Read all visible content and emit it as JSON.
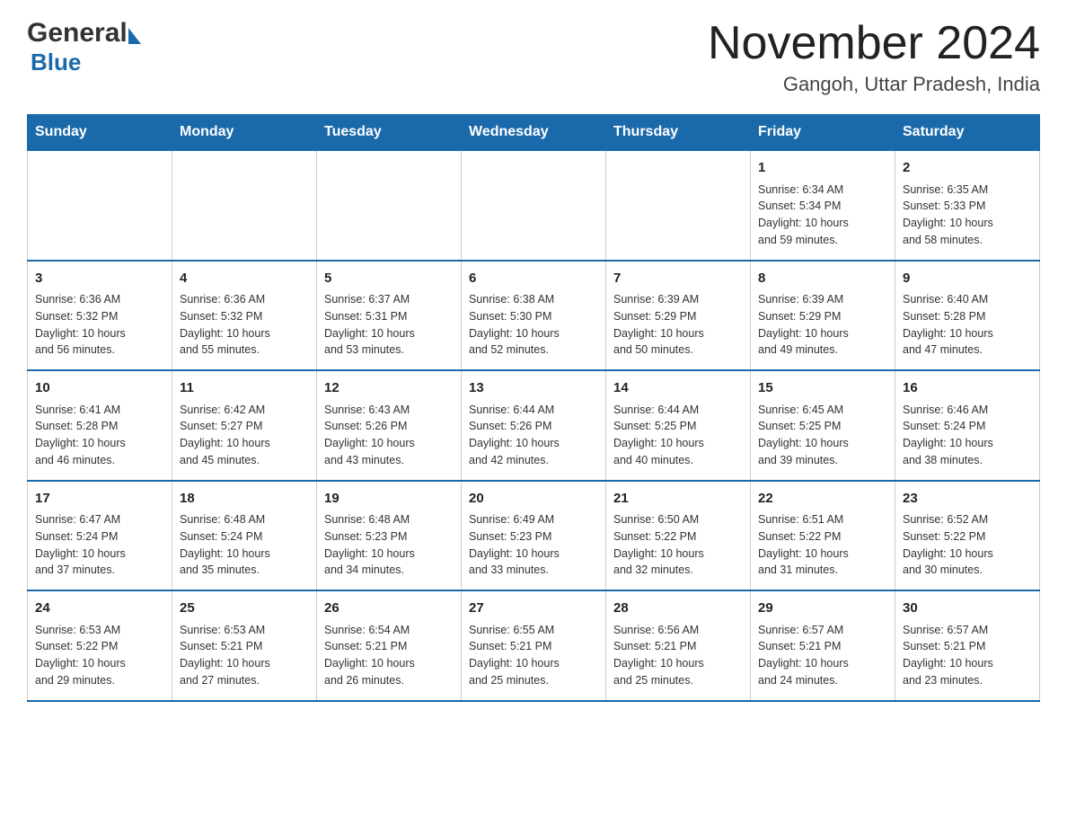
{
  "header": {
    "title": "November 2024",
    "location": "Gangoh, Uttar Pradesh, India",
    "logo_general": "General",
    "logo_blue": "Blue"
  },
  "calendar": {
    "days_of_week": [
      "Sunday",
      "Monday",
      "Tuesday",
      "Wednesday",
      "Thursday",
      "Friday",
      "Saturday"
    ],
    "weeks": [
      [
        {
          "day": "",
          "info": ""
        },
        {
          "day": "",
          "info": ""
        },
        {
          "day": "",
          "info": ""
        },
        {
          "day": "",
          "info": ""
        },
        {
          "day": "",
          "info": ""
        },
        {
          "day": "1",
          "info": "Sunrise: 6:34 AM\nSunset: 5:34 PM\nDaylight: 10 hours\nand 59 minutes."
        },
        {
          "day": "2",
          "info": "Sunrise: 6:35 AM\nSunset: 5:33 PM\nDaylight: 10 hours\nand 58 minutes."
        }
      ],
      [
        {
          "day": "3",
          "info": "Sunrise: 6:36 AM\nSunset: 5:32 PM\nDaylight: 10 hours\nand 56 minutes."
        },
        {
          "day": "4",
          "info": "Sunrise: 6:36 AM\nSunset: 5:32 PM\nDaylight: 10 hours\nand 55 minutes."
        },
        {
          "day": "5",
          "info": "Sunrise: 6:37 AM\nSunset: 5:31 PM\nDaylight: 10 hours\nand 53 minutes."
        },
        {
          "day": "6",
          "info": "Sunrise: 6:38 AM\nSunset: 5:30 PM\nDaylight: 10 hours\nand 52 minutes."
        },
        {
          "day": "7",
          "info": "Sunrise: 6:39 AM\nSunset: 5:29 PM\nDaylight: 10 hours\nand 50 minutes."
        },
        {
          "day": "8",
          "info": "Sunrise: 6:39 AM\nSunset: 5:29 PM\nDaylight: 10 hours\nand 49 minutes."
        },
        {
          "day": "9",
          "info": "Sunrise: 6:40 AM\nSunset: 5:28 PM\nDaylight: 10 hours\nand 47 minutes."
        }
      ],
      [
        {
          "day": "10",
          "info": "Sunrise: 6:41 AM\nSunset: 5:28 PM\nDaylight: 10 hours\nand 46 minutes."
        },
        {
          "day": "11",
          "info": "Sunrise: 6:42 AM\nSunset: 5:27 PM\nDaylight: 10 hours\nand 45 minutes."
        },
        {
          "day": "12",
          "info": "Sunrise: 6:43 AM\nSunset: 5:26 PM\nDaylight: 10 hours\nand 43 minutes."
        },
        {
          "day": "13",
          "info": "Sunrise: 6:44 AM\nSunset: 5:26 PM\nDaylight: 10 hours\nand 42 minutes."
        },
        {
          "day": "14",
          "info": "Sunrise: 6:44 AM\nSunset: 5:25 PM\nDaylight: 10 hours\nand 40 minutes."
        },
        {
          "day": "15",
          "info": "Sunrise: 6:45 AM\nSunset: 5:25 PM\nDaylight: 10 hours\nand 39 minutes."
        },
        {
          "day": "16",
          "info": "Sunrise: 6:46 AM\nSunset: 5:24 PM\nDaylight: 10 hours\nand 38 minutes."
        }
      ],
      [
        {
          "day": "17",
          "info": "Sunrise: 6:47 AM\nSunset: 5:24 PM\nDaylight: 10 hours\nand 37 minutes."
        },
        {
          "day": "18",
          "info": "Sunrise: 6:48 AM\nSunset: 5:24 PM\nDaylight: 10 hours\nand 35 minutes."
        },
        {
          "day": "19",
          "info": "Sunrise: 6:48 AM\nSunset: 5:23 PM\nDaylight: 10 hours\nand 34 minutes."
        },
        {
          "day": "20",
          "info": "Sunrise: 6:49 AM\nSunset: 5:23 PM\nDaylight: 10 hours\nand 33 minutes."
        },
        {
          "day": "21",
          "info": "Sunrise: 6:50 AM\nSunset: 5:22 PM\nDaylight: 10 hours\nand 32 minutes."
        },
        {
          "day": "22",
          "info": "Sunrise: 6:51 AM\nSunset: 5:22 PM\nDaylight: 10 hours\nand 31 minutes."
        },
        {
          "day": "23",
          "info": "Sunrise: 6:52 AM\nSunset: 5:22 PM\nDaylight: 10 hours\nand 30 minutes."
        }
      ],
      [
        {
          "day": "24",
          "info": "Sunrise: 6:53 AM\nSunset: 5:22 PM\nDaylight: 10 hours\nand 29 minutes."
        },
        {
          "day": "25",
          "info": "Sunrise: 6:53 AM\nSunset: 5:21 PM\nDaylight: 10 hours\nand 27 minutes."
        },
        {
          "day": "26",
          "info": "Sunrise: 6:54 AM\nSunset: 5:21 PM\nDaylight: 10 hours\nand 26 minutes."
        },
        {
          "day": "27",
          "info": "Sunrise: 6:55 AM\nSunset: 5:21 PM\nDaylight: 10 hours\nand 25 minutes."
        },
        {
          "day": "28",
          "info": "Sunrise: 6:56 AM\nSunset: 5:21 PM\nDaylight: 10 hours\nand 25 minutes."
        },
        {
          "day": "29",
          "info": "Sunrise: 6:57 AM\nSunset: 5:21 PM\nDaylight: 10 hours\nand 24 minutes."
        },
        {
          "day": "30",
          "info": "Sunrise: 6:57 AM\nSunset: 5:21 PM\nDaylight: 10 hours\nand 23 minutes."
        }
      ]
    ]
  },
  "colors": {
    "header_bg": "#1a6aab",
    "header_text": "#ffffff",
    "border": "#cccccc",
    "day_num": "#222222",
    "body_text": "#333333"
  }
}
